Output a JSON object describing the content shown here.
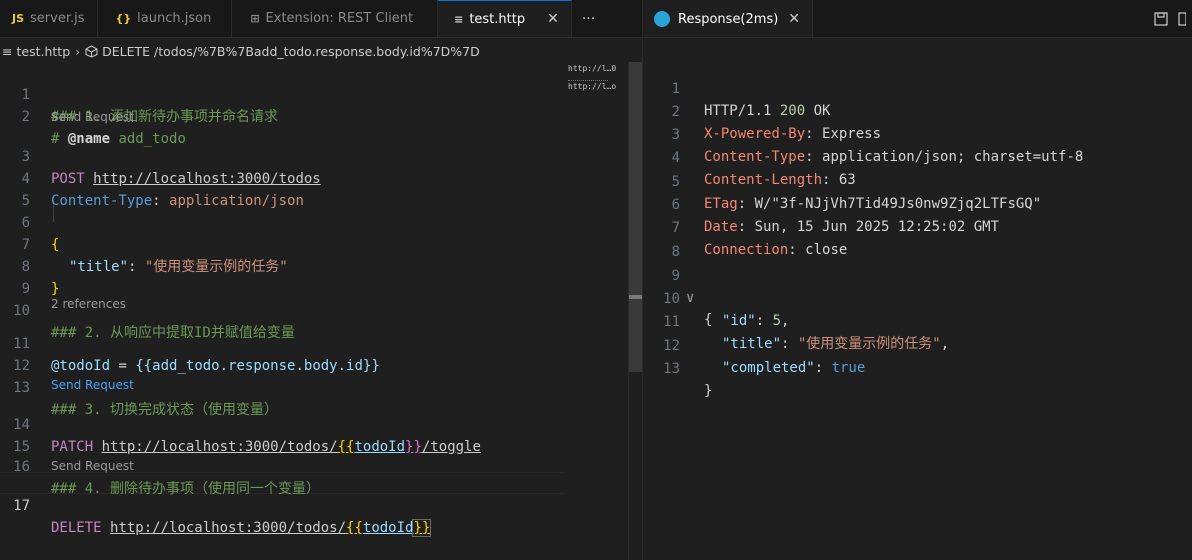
{
  "left_tabs": [
    {
      "icon": "JS",
      "label": "server.js"
    },
    {
      "icon": "{}",
      "label": "launch.json"
    },
    {
      "icon": "⊞",
      "label": "Extension: REST Client"
    },
    {
      "icon": "≡",
      "label": "test.http"
    }
  ],
  "left_more": "···",
  "right_tab": {
    "label": "Response(2ms)"
  },
  "close_glyph": "✕",
  "breadcrumb": {
    "file": "test.http",
    "symbol": "DELETE /todos/%7B%7Badd_todo.response.body.id%7D%7D"
  },
  "request_lines": {
    "l1": "### 1. 添加新待办事项并命名请求",
    "l2_prefix": "# ",
    "l2_name": "@name",
    "l2_value": " add_todo",
    "lens1": "Send Request",
    "l3_method": "POST",
    "l3_url": "http://localhost:3000/todos",
    "l4_header": "Content-Type",
    "l4_value": "application/json",
    "l6": "{",
    "l7_key": "\"title\"",
    "l7_value": "\"使用变量示例的任务\"",
    "l8": "}",
    "l10": "### 2. 从响应中提取ID并赋值给变量",
    "lens2": "2 references",
    "l11_var": "@todoId",
    "l11_eq": " = ",
    "l11_expr": "{{add_todo.response.body.id}}",
    "l13": "### 3. 切换完成状态（使用变量）",
    "lens3": "Send Request",
    "l14_method": "PATCH",
    "l14_url_a": "http://localhost:3000/todos/",
    "l14_brace_open": "{{",
    "l14_var": "todoId",
    "l14_brace_close": "}}",
    "l14_url_b": "/toggle",
    "l16": "### 4. 删除待办事项（使用同一个变量）",
    "lens4": "Send Request",
    "l17_method": "DELETE",
    "l17_url_a": "http://localhost:3000/todos/",
    "l17_brace_open": "{{",
    "l17_var": "todoId",
    "l17_brace_close": "}}"
  },
  "left_line_numbers": [
    "1",
    "2",
    "3",
    "4",
    "5",
    "6",
    "7",
    "8",
    "9",
    "10",
    "11",
    "12",
    "13",
    "14",
    "15",
    "16",
    "17"
  ],
  "minimap": [
    "http://l…0",
    "http://l…o"
  ],
  "response": {
    "status_proto": "HTTP/1.1 ",
    "status_code": "200",
    "status_text": " OK",
    "headers": [
      {
        "name": "X-Powered-By",
        "value": "Express"
      },
      {
        "name": "Content-Type",
        "value": "application/json; charset=utf-8"
      },
      {
        "name": "Content-Length",
        "value": "63"
      },
      {
        "name": "ETag",
        "value": "W/\"3f-NJjVh7Tid49Js0nw9Zjq2LTFsGQ\""
      },
      {
        "name": "Date",
        "value": "Sun, 15 Jun 2025 12:25:02 GMT"
      },
      {
        "name": "Connection",
        "value": "close"
      }
    ],
    "body_open": "{",
    "body_id_key": "\"id\"",
    "body_id_val": "5",
    "body_title_key": "\"title\"",
    "body_title_val": "\"使用变量示例的任务\"",
    "body_completed_key": "\"completed\"",
    "body_completed_val": "true",
    "body_close": "}",
    "line_numbers": [
      "1",
      "2",
      "3",
      "4",
      "5",
      "6",
      "7",
      "8",
      "9",
      "10",
      "11",
      "12",
      "13"
    ]
  },
  "colors": {
    "accent": "#0078d4",
    "editor_bg": "#1f1f1f",
    "comment": "#6a9955",
    "header_name": "#f48771"
  }
}
